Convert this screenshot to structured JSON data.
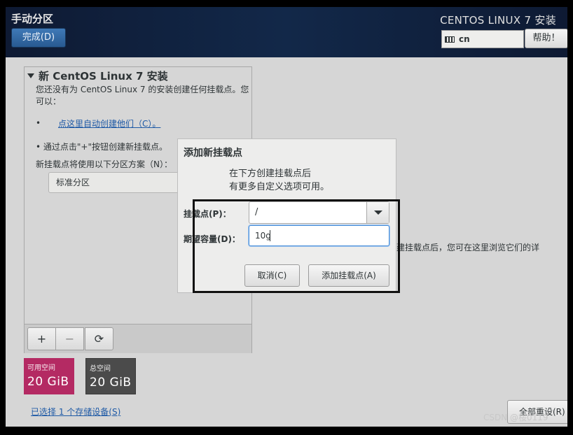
{
  "header": {
    "page_title": "手动分区",
    "done_label": "完成(D)",
    "product_title": "CENTOS LINUX 7 安装",
    "keyboard_layout": "cn",
    "help_label": "帮助！"
  },
  "left_panel": {
    "install_title": "新 CentOS Linux 7 安装",
    "description": "您还没有为 CentOS Linux 7 的安装创建任何挂载点。您可以：",
    "bullet": "•",
    "auto_link": "点这里自动创建他们（C）。",
    "manual_hint": "• 通过点击\"+\"按钮创建新挂载点。",
    "scheme_label": "新挂载点将使用以下分区方案（N）：",
    "scheme_value": "标准分区",
    "toolbar": {
      "add": "+",
      "remove": "−",
      "refresh": "⟳"
    }
  },
  "space": {
    "available_label": "可用空间",
    "available_value": "20 GiB",
    "total_label": "总空间",
    "total_value": "20 GiB"
  },
  "storage_link": "已选择 1 个存储设备(S)",
  "reset_label": "全部重设(R)",
  "right_text": "建挂载点后，您可在这里浏览它们的详",
  "watermark": "CSDN @桜0119",
  "dialog": {
    "title": "添加新挂载点",
    "desc_line1": "在下方创建挂载点后",
    "desc_line2": "有更多自定义选项可用。",
    "mount_label": "挂载点(P)：",
    "mount_value": "/",
    "capacity_label": "期望容量(D)：",
    "capacity_value": "10g",
    "cancel_label": "取消(C)",
    "add_label": "添加挂载点(A)"
  }
}
